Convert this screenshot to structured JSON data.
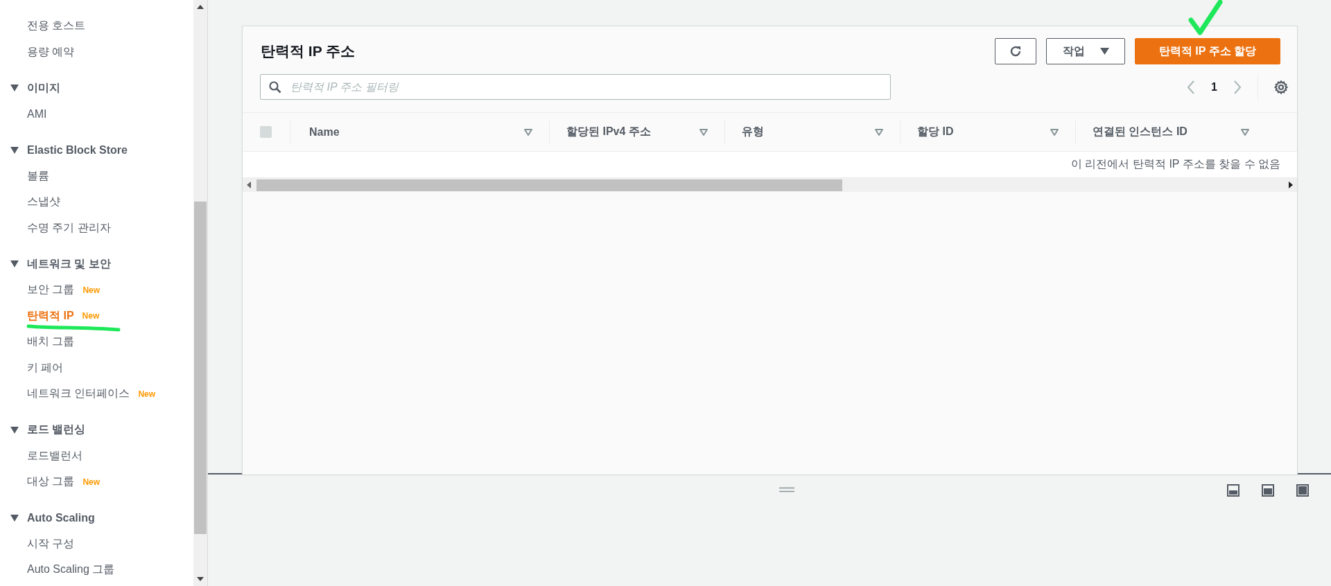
{
  "sidebar": {
    "groups": [
      {
        "items": [
          {
            "label": "전용 호스트",
            "selected": false
          },
          {
            "label": "용량 예약",
            "selected": false
          }
        ]
      },
      {
        "title": "이미지",
        "expanded": true,
        "items": [
          {
            "label": "AMI",
            "selected": false
          }
        ]
      },
      {
        "title": "Elastic Block Store",
        "expanded": true,
        "items": [
          {
            "label": "볼륨",
            "selected": false
          },
          {
            "label": "스냅샷",
            "selected": false
          },
          {
            "label": "수명 주기 관리자",
            "selected": false
          }
        ]
      },
      {
        "title": "네트워크 및 보안",
        "expanded": true,
        "items": [
          {
            "label": "보안 그룹",
            "selected": false,
            "badge": "New"
          },
          {
            "label": "탄력적 IP",
            "selected": true,
            "badge": "New"
          },
          {
            "label": "배치 그룹",
            "selected": false
          },
          {
            "label": "키 페어",
            "selected": false
          },
          {
            "label": "네트워크 인터페이스",
            "selected": false,
            "badge": "New"
          }
        ]
      },
      {
        "title": "로드 밸런싱",
        "expanded": true,
        "items": [
          {
            "label": "로드밸런서",
            "selected": false
          },
          {
            "label": "대상 그룹",
            "selected": false,
            "badge": "New"
          }
        ]
      },
      {
        "title": "Auto Scaling",
        "expanded": true,
        "items": [
          {
            "label": "시작 구성",
            "selected": false
          },
          {
            "label": "Auto Scaling 그룹",
            "selected": false
          }
        ]
      }
    ]
  },
  "panel": {
    "title": "탄력적 IP 주소",
    "actions_button": "작업",
    "primary_button": "탄력적 IP 주소 할당",
    "search": {
      "placeholder": "탄력적 IP 주소 필터링"
    },
    "pagination": {
      "page": "1"
    },
    "table": {
      "select_all_checked": false,
      "columns": [
        "Name",
        "할당된 IPv4 주소",
        "유형",
        "할당 ID",
        "연결된 인스턴스 ID"
      ],
      "empty_message": "이 리전에서 탄력적 IP 주소를 찾을 수 없음"
    }
  }
}
